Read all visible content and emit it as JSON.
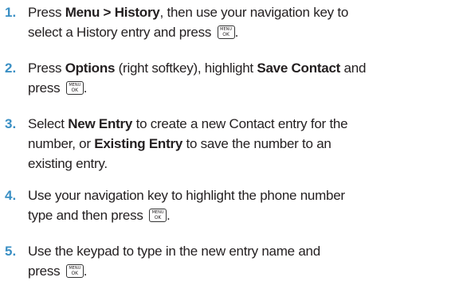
{
  "steps": [
    {
      "number": "1.",
      "lines": [
        [
          {
            "t": "Press "
          },
          {
            "t": "Menu > History",
            "b": true
          },
          {
            "t": ", then use your navigation key to"
          }
        ],
        [
          {
            "t": "select a History entry and press "
          },
          {
            "key": true
          },
          {
            "t": "."
          }
        ]
      ]
    },
    {
      "number": "2.",
      "lines": [
        [
          {
            "t": "Press "
          },
          {
            "t": "Options",
            "b": true
          },
          {
            "t": " (right softkey), highlight "
          },
          {
            "t": "Save Contact",
            "b": true
          },
          {
            "t": " and"
          }
        ],
        [
          {
            "t": "press "
          },
          {
            "key": true
          },
          {
            "t": "."
          }
        ]
      ]
    },
    {
      "number": "3.",
      "lines": [
        [
          {
            "t": "Select "
          },
          {
            "t": "New Entry",
            "b": true
          },
          {
            "t": " to create a new Contact entry for the"
          }
        ],
        [
          {
            "t": "number, or "
          },
          {
            "t": "Existing Entry",
            "b": true
          },
          {
            "t": " to save the number to an"
          }
        ],
        [
          {
            "t": "existing entry."
          }
        ]
      ]
    },
    {
      "number": "4.",
      "lines": [
        [
          {
            "t": "Use your navigation key to highlight the phone number"
          }
        ],
        [
          {
            "t": "type and then press "
          },
          {
            "key": true
          },
          {
            "t": "."
          }
        ]
      ]
    },
    {
      "number": "5.",
      "lines": [
        [
          {
            "t": "Use the keypad to type in the new entry name and"
          }
        ],
        [
          {
            "t": "press "
          },
          {
            "key": true
          },
          {
            "t": "."
          }
        ]
      ]
    }
  ],
  "key_icon": {
    "name": "menu-ok-key-icon",
    "top_label": "MENU",
    "bottom_label": "OK"
  }
}
